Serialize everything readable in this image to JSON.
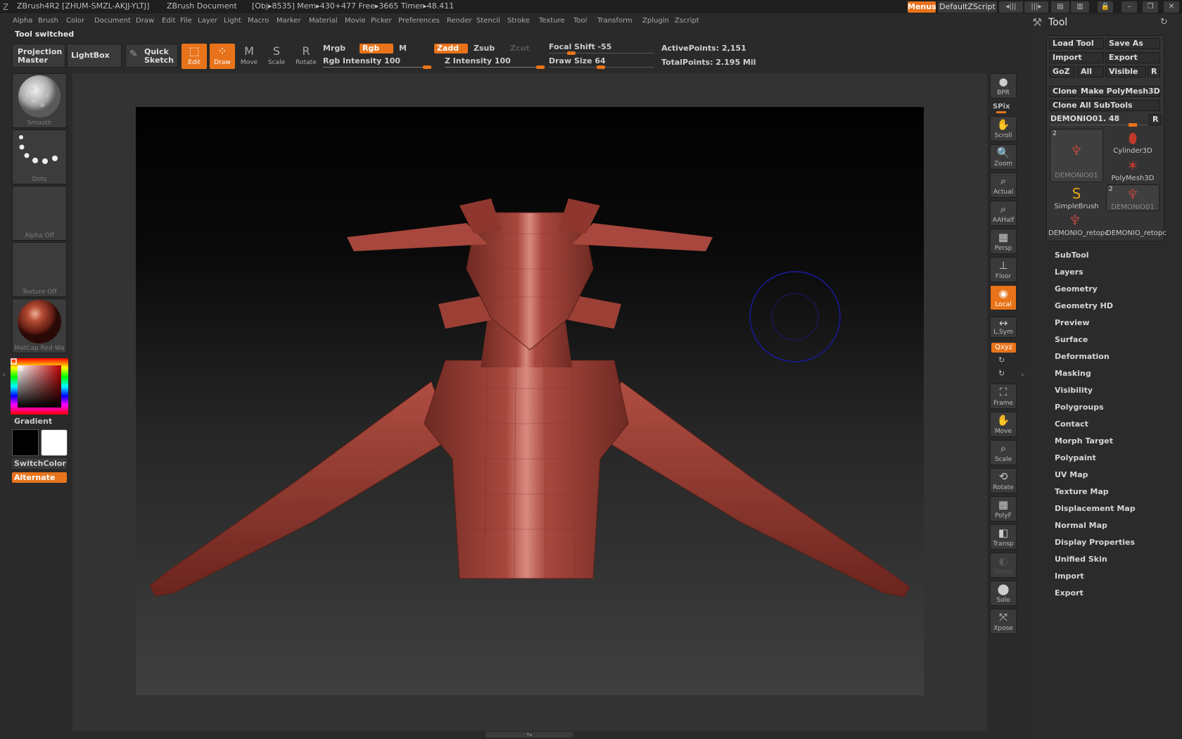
{
  "titlebar": {
    "app": "ZBrush4R2",
    "id": "[ZHUM-SMZL-AKJJ-YLTJ]",
    "document": "ZBrush Document",
    "stats": "[Obj▸8535]  Mem▸430+477  Free▸3665  Timer▸48.411",
    "menus_label": "Menus",
    "script_label": "DefaultZScript"
  },
  "menubar": [
    "Alpha",
    "Brush",
    "Color",
    "Document",
    "Draw",
    "Edit",
    "File",
    "Layer",
    "Light",
    "Macro",
    "Marker",
    "Material",
    "Movie",
    "Picker",
    "Preferences",
    "Render",
    "Stencil",
    "Stroke",
    "Texture",
    "Tool",
    "Transform",
    "Zplugin",
    "Zscript"
  ],
  "status": "Tool switched",
  "shelf": {
    "projection_master": "Projection Master",
    "lightbox": "LightBox",
    "quick_sketch": "Quick Sketch",
    "modes": {
      "edit": "Edit",
      "draw": "Draw",
      "move": "Move",
      "scale": "Scale",
      "rotate": "Rotate"
    },
    "mrgb": "Mrgb",
    "rgb": "Rgb",
    "m": "M",
    "zadd": "Zadd",
    "zsub": "Zsub",
    "zcut": "Zcut",
    "rgb_intensity": "Rgb Intensity 100",
    "z_intensity": "Z Intensity 100",
    "focal_shift": "Focal Shift -55",
    "draw_size": "Draw Size 64",
    "active_points": "ActivePoints: 2,151",
    "total_points": "TotalPoints: 2.195 Mil"
  },
  "left": {
    "brush": "Smooth",
    "stroke": "Dots",
    "alpha": "Alpha Off",
    "texture": "Texture Off",
    "material": "MatCap Red Wa",
    "gradient": "Gradient",
    "switchcolor": "SwitchColor",
    "alternate": "Alternate"
  },
  "right_shelf": {
    "bpr": "BPR",
    "spix": "SPix",
    "scroll": "Scroll",
    "zoom": "Zoom",
    "actual": "Actual",
    "aahalf": "AAHalf",
    "persp": "Persp",
    "floor": "Floor",
    "local": "Local",
    "lsym": "L.Sym",
    "xyz": "Qxyz",
    "frame": "Frame",
    "move": "Move",
    "scale": "Scale",
    "rotate": "Rotate",
    "polyf": "PolyF",
    "transp": "Transp",
    "ghost": "Ghost",
    "solo": "Solo",
    "xpose": "Xpose"
  },
  "tool": {
    "title": "Tool",
    "load_tool": "Load Tool",
    "save_as": "Save As",
    "import": "Import",
    "export": "Export",
    "goz": "GoZ",
    "all": "All",
    "visible": "Visible",
    "r": "R",
    "clone": "Clone",
    "make_polymesh": "Make PolyMesh3D",
    "clone_all": "Clone All SubTools",
    "current": "DEMONIO01. 48",
    "r2": "R",
    "thumbs": [
      {
        "name": "DEMONIO01",
        "count": "2"
      },
      {
        "name": "Cylinder3D"
      },
      {
        "name": "PolyMesh3D"
      },
      {
        "name": "SimpleBrush"
      },
      {
        "name": "DEMONIO01",
        "count": "2"
      },
      {
        "name": "DEMONIO_retopc"
      },
      {
        "name": "DEMONIO_retopc"
      }
    ],
    "subpalettes": [
      "SubTool",
      "Layers",
      "Geometry",
      "Geometry HD",
      "Preview",
      "Surface",
      "Deformation",
      "Masking",
      "Visibility",
      "Polygroups",
      "Contact",
      "Morph Target",
      "Polypaint",
      "UV Map",
      "Texture Map",
      "Displacement Map",
      "Normal Map",
      "Display Properties",
      "Unified Skin",
      "Import",
      "Export"
    ]
  },
  "colors": {
    "accent": "#e8731a",
    "model": "#a8473d",
    "cursor": "#1a1a9a"
  },
  "icons": {
    "app": "zbrush-logo-icon",
    "tool": "hammer-icon",
    "refresh": "refresh-icon"
  }
}
